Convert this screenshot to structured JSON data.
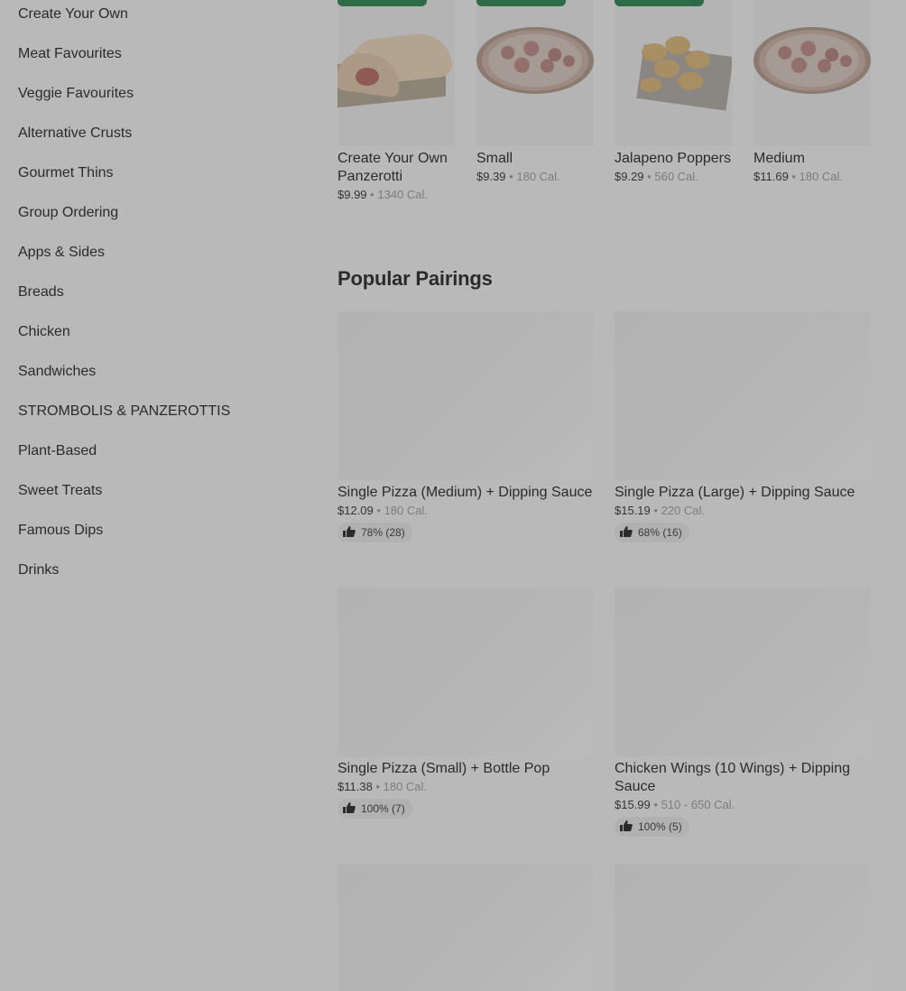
{
  "sidebar": {
    "items": [
      {
        "label": "Create Your Own"
      },
      {
        "label": "Meat Favourites"
      },
      {
        "label": "Veggie Favourites"
      },
      {
        "label": "Alternative Crusts"
      },
      {
        "label": "Gourmet Thins"
      },
      {
        "label": "Group Ordering"
      },
      {
        "label": "Apps & Sides"
      },
      {
        "label": "Breads"
      },
      {
        "label": "Chicken"
      },
      {
        "label": "Sandwiches"
      },
      {
        "label": "STROMBOLIS & PANZEROTTIS"
      },
      {
        "label": "Plant-Based"
      },
      {
        "label": "Sweet Treats"
      },
      {
        "label": "Famous Dips"
      },
      {
        "label": "Drinks"
      }
    ]
  },
  "carousel": {
    "items": [
      {
        "name": "Create Your Own Panzerotti",
        "price": "$9.99",
        "sep": "•",
        "cal": "1340 Cal."
      },
      {
        "name": "Small",
        "price": "$9.39",
        "sep": "•",
        "cal": "180 Cal."
      },
      {
        "name": "Jalapeno Poppers",
        "price": "$9.29",
        "sep": "•",
        "cal": "560 Cal."
      },
      {
        "name": "Medium",
        "price": "$11.69",
        "sep": "•",
        "cal": "180 Cal."
      }
    ]
  },
  "pairings": {
    "title": "Popular Pairings",
    "items": [
      {
        "name": "Single Pizza (Medium) + Dipping Sauce",
        "price": "$12.09",
        "sep": "•",
        "cal": "180 Cal.",
        "rating": "78% (28)"
      },
      {
        "name": "Single Pizza (Large) + Dipping Sauce",
        "price": "$15.19",
        "sep": "•",
        "cal": "220 Cal.",
        "rating": "68% (16)"
      },
      {
        "name": "Single Pizza (Small) + Bottle Pop",
        "price": "$11.38",
        "sep": "•",
        "cal": "180 Cal.",
        "rating": "100% (7)"
      },
      {
        "name": "Chicken Wings (10 Wings) + Dipping Sauce",
        "price": "$15.99",
        "sep": "•",
        "cal": "510 - 650 Cal.",
        "rating": "100% (5)"
      }
    ]
  },
  "colors": {
    "badge": "#2c6b46",
    "overlay_bg": "#b9b9b9"
  }
}
